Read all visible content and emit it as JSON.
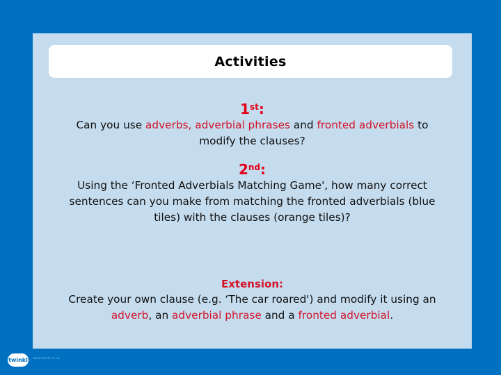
{
  "title": "Activities",
  "sections": [
    {
      "heading_num": "1",
      "heading_sup": "st",
      "heading_suffix": ":",
      "parts": [
        {
          "text": "Can you use ",
          "red": false
        },
        {
          "text": "adverbs, adverbial phrases",
          "red": true
        },
        {
          "text": " and ",
          "red": false
        },
        {
          "text": "fronted adverbials",
          "red": true
        },
        {
          "text": " to modify the clauses?",
          "red": false
        }
      ]
    },
    {
      "heading_num": "2",
      "heading_sup": "nd",
      "heading_suffix": ":",
      "parts": [
        {
          "text": "Using the ‘Fronted Adverbials Matching Game', how many correct sentences can you make from matching the fronted adverbials (blue tiles) with the clauses (orange tiles)?",
          "red": false
        }
      ]
    }
  ],
  "extension": {
    "heading": "Extension:",
    "parts": [
      {
        "text": "Create your own clause (e.g. ‘The car roared') and modify it using an ",
        "red": false
      },
      {
        "text": "adverb",
        "red": true
      },
      {
        "text": ", an ",
        "red": false
      },
      {
        "text": "adverbial phrase",
        "red": true
      },
      {
        "text": " and a ",
        "red": false
      },
      {
        "text": "fronted adverbial",
        "red": true
      },
      {
        "text": ".",
        "red": false
      }
    ]
  },
  "footer": {
    "logo_text": "twinkl",
    "url": "www.twinkl.co.uk"
  },
  "colors": {
    "background": "#0070c0",
    "panel": "#c5dcee",
    "accent_red": "#d2142a"
  }
}
